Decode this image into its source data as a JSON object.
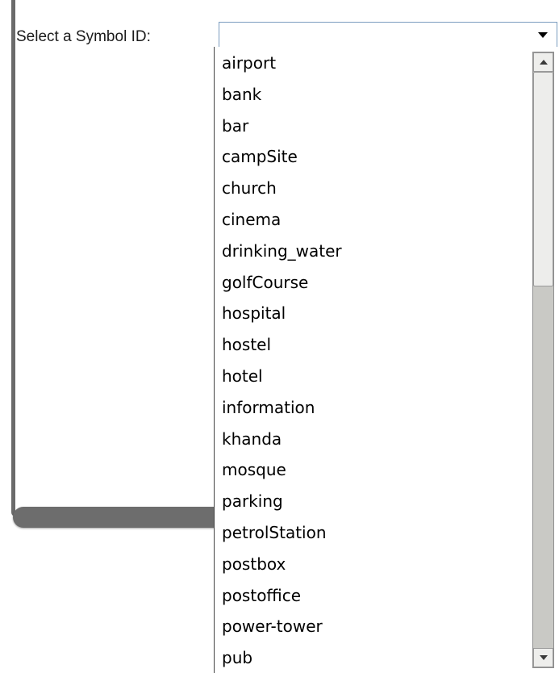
{
  "form": {
    "label": "Select a Symbol ID:",
    "select": {
      "selected_value": "",
      "arrow_icon": "triangle-down-icon"
    }
  },
  "dropdown": {
    "options": [
      "airport",
      "bank",
      "bar",
      "campSite",
      "church",
      "cinema",
      "drinking_water",
      "golfCourse",
      "hospital",
      "hostel",
      "hotel",
      "information",
      "khanda",
      "mosque",
      "parking",
      "petrolStation",
      "postbox",
      "postoffice",
      "power-tower",
      "pub"
    ],
    "scrollbar": {
      "up_icon": "scroll-up-arrow-icon",
      "down_icon": "scroll-down-arrow-icon",
      "scroll_fraction": 0.0
    }
  },
  "colors": {
    "panel_border": "#6b6b6b",
    "select_border": "#7a9cbf",
    "scroll_track": "#c9c9c5"
  }
}
